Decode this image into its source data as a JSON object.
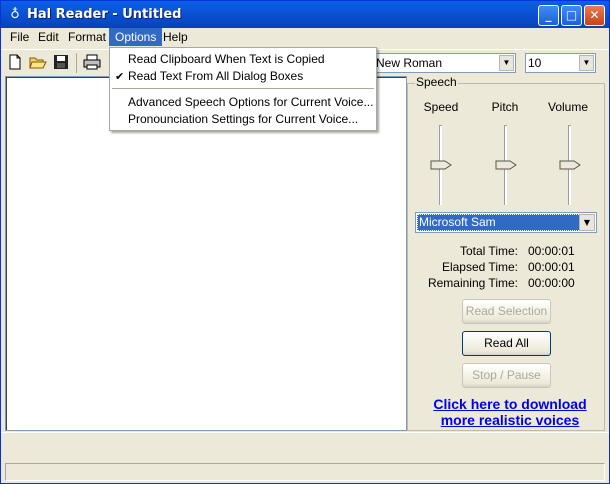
{
  "window": {
    "title": "Hal Reader - Untitled"
  },
  "menubar": [
    "File",
    "Edit",
    "Format",
    "Options",
    "Help"
  ],
  "active_menu": "Options",
  "options_menu": {
    "items": [
      {
        "label": "Read Clipboard When Text is Copied",
        "checked": false
      },
      {
        "label": "Read Text From All Dialog Boxes",
        "checked": true
      },
      {
        "label": "Advanced Speech Options for Current Voice...",
        "checked": false
      },
      {
        "label": "Pronounciation Settings for Current Voice...",
        "checked": false
      }
    ],
    "check_mark": "✔"
  },
  "toolbar": {
    "icons": [
      "new-file-icon",
      "open-folder-icon",
      "save-disk-icon",
      "print-icon"
    ],
    "font_value": "New Roman",
    "size_value": "10"
  },
  "speech": {
    "group_label": "Speech",
    "sliders": [
      {
        "label": "Speed",
        "level": 0.5
      },
      {
        "label": "Pitch",
        "level": 0.5
      },
      {
        "label": "Volume",
        "level": 0.5
      }
    ],
    "voice": "Microsoft Sam",
    "times": [
      {
        "label": "Total Time:",
        "value": "00:00:01"
      },
      {
        "label": "Elapsed Time:",
        "value": "00:00:01"
      },
      {
        "label": "Remaining Time:",
        "value": "00:00:00"
      }
    ],
    "buttons": [
      {
        "label": "Read Selection",
        "enabled": false
      },
      {
        "label": "Read All",
        "enabled": true
      },
      {
        "label": "Stop / Pause",
        "enabled": false
      }
    ],
    "download_link_line1": "Click here to download",
    "download_link_line2": "more realistic voices"
  },
  "colors": {
    "title_bar": "#0b53d6",
    "menu_highlight": "#316ac5",
    "link": "#0000ee"
  }
}
